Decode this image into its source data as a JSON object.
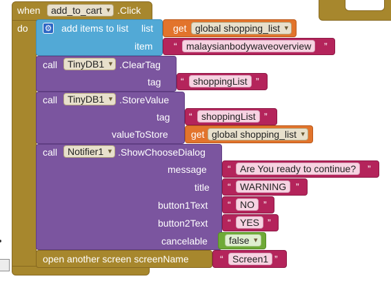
{
  "event": {
    "when": "when",
    "component": "add_to_cart",
    "event_name": ".Click",
    "do": "do"
  },
  "list_block": {
    "label": "add items to list",
    "list_label": "list",
    "item_label": "item",
    "get": "get",
    "variable": "global shopping_list",
    "item_value": "malaysianbodywaveoverview"
  },
  "clear_tag": {
    "call": "call",
    "component": "TinyDB1",
    "method": ".ClearTag",
    "tag_label": "tag",
    "tag_value": "shoppingList"
  },
  "store_value": {
    "call": "call",
    "component": "TinyDB1",
    "method": ".StoreValue",
    "tag_label": "tag",
    "tag_value": "shoppingList",
    "value_label": "valueToStore",
    "get": "get",
    "variable": "global shopping_list"
  },
  "dialog": {
    "call": "call",
    "component": "Notifier1",
    "method": ".ShowChooseDialog",
    "message_label": "message",
    "message_value": "Are You ready to continue?",
    "title_label": "title",
    "title_value": "WARNING",
    "button1_label": "button1Text",
    "button1_value": "NO",
    "button2_label": "button2Text",
    "button2_value": "YES",
    "cancel_label": "cancelable",
    "cancel_value": "false"
  },
  "open_screen": {
    "label": "open another screen  screenName",
    "value": "Screen1"
  },
  "quote": "“",
  "quote_close": "”",
  "colors": {
    "event": "#a7872d",
    "list": "#52a9d6",
    "component": "#7b559f",
    "variable": "#e2742c",
    "text": "#b4245b",
    "logic": "#6faa37"
  }
}
